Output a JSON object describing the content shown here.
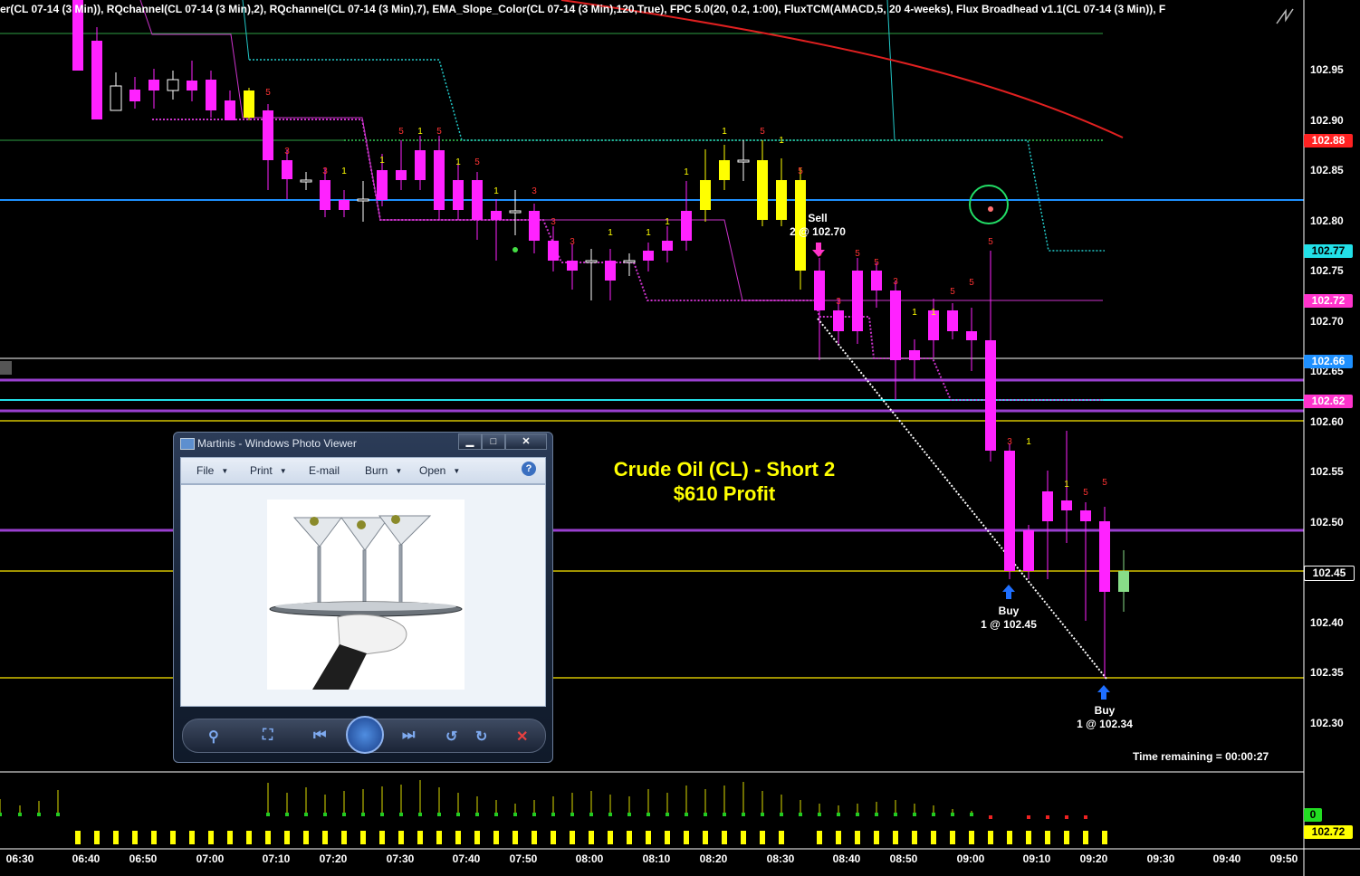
{
  "header": {
    "indicators_text": "er(CL 07-14 (3 Min)),  RQchannel(CL 07-14 (3 Min),2),  RQchannel(CL 07-14 (3 Min),7),  EMA_Slope_Color(CL 07-14 (3 Min),120,True),  FPC 5.0(20, 0.2, 1:00),  FluxTCM(AMACD,5, 20 4-weeks),  Flux Broadhead v1.1(CL 07-14 (3 Min)),  F"
  },
  "y_axis": {
    "labels": [
      "102.95",
      "102.90",
      "102.85",
      "102.80",
      "102.75",
      "102.70",
      "102.65",
      "102.60",
      "102.55",
      "102.50",
      "102.45",
      "102.40",
      "102.35",
      "102.30"
    ]
  },
  "price_tags": [
    {
      "value": "102.88",
      "color": "#ff2222",
      "text_color": "#ffffff"
    },
    {
      "value": "102.77",
      "color": "#22e0e8",
      "text_color": "#000000"
    },
    {
      "value": "102.72",
      "color": "#ff33cc",
      "text_color": "#ffffff"
    },
    {
      "value": "102.66",
      "color": "#1e90ff",
      "text_color": "#ffffff"
    },
    {
      "value": "102.62",
      "color": "#ff33cc",
      "text_color": "#ffffff"
    },
    {
      "value": "102.45",
      "color": "#000000",
      "text_color": "#ffffff"
    }
  ],
  "x_axis": {
    "labels": [
      "06:30",
      "06:40",
      "06:50",
      "07:00",
      "07:10",
      "07:20",
      "07:30",
      "07:40",
      "07:50",
      "08:00",
      "08:10",
      "08:20",
      "08:30",
      "08:40",
      "08:50",
      "09:00",
      "09:10",
      "09:20",
      "09:30",
      "09:40",
      "09:50"
    ]
  },
  "annotations": {
    "title_line1": "Crude Oil (CL) - Short 2",
    "title_line2": "$610 Profit",
    "sell_line1": "Sell",
    "sell_line2": "2 @ 102.70",
    "buy1_line1": "Buy",
    "buy1_line2": "1 @ 102.45",
    "buy2_line1": "Buy",
    "buy2_line2": "1 @ 102.34",
    "time_remaining": "Time remaining = 00:00:27"
  },
  "lower_panel": {
    "value_tag": "0",
    "price_tag": "102.72"
  },
  "photo_viewer": {
    "title": "Martinis - Windows Photo Viewer",
    "menu": [
      "File",
      "Print",
      "E-mail",
      "Burn",
      "Open"
    ],
    "min_label": "▁",
    "max_label": "□",
    "close_label": "✕",
    "help_label": "?"
  }
}
